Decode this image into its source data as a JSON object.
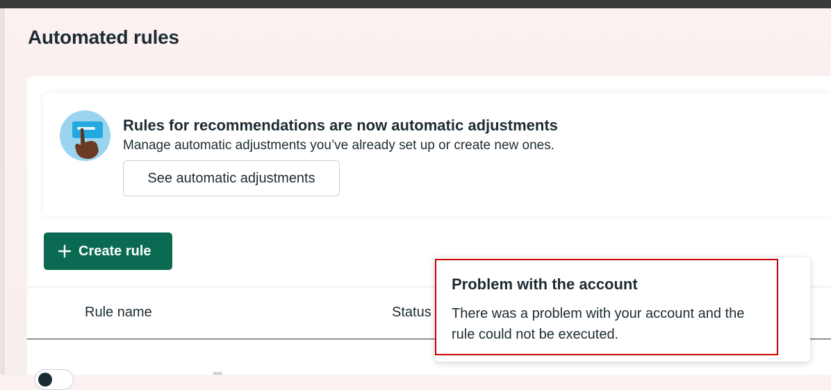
{
  "page": {
    "title": "Automated rules"
  },
  "banner": {
    "illustration": "hand-pointing-card-illustration",
    "title": "Rules for recommendations are now automatic adjustments",
    "subtitle": "Manage automatic adjustments you’ve already set up or create new ones.",
    "button_label": "See automatic adjustments"
  },
  "toolbar": {
    "create_label": "Create rule",
    "create_icon": "plus-icon"
  },
  "table": {
    "columns": [
      "Rule name",
      "Status"
    ]
  },
  "tooltip": {
    "title": "Problem with the account",
    "body": "There was a problem with your account and the rule could not be executed."
  },
  "colors": {
    "primary_button": "#0a6b52",
    "highlight_border": "#cc0000",
    "text": "#1c2b33"
  }
}
